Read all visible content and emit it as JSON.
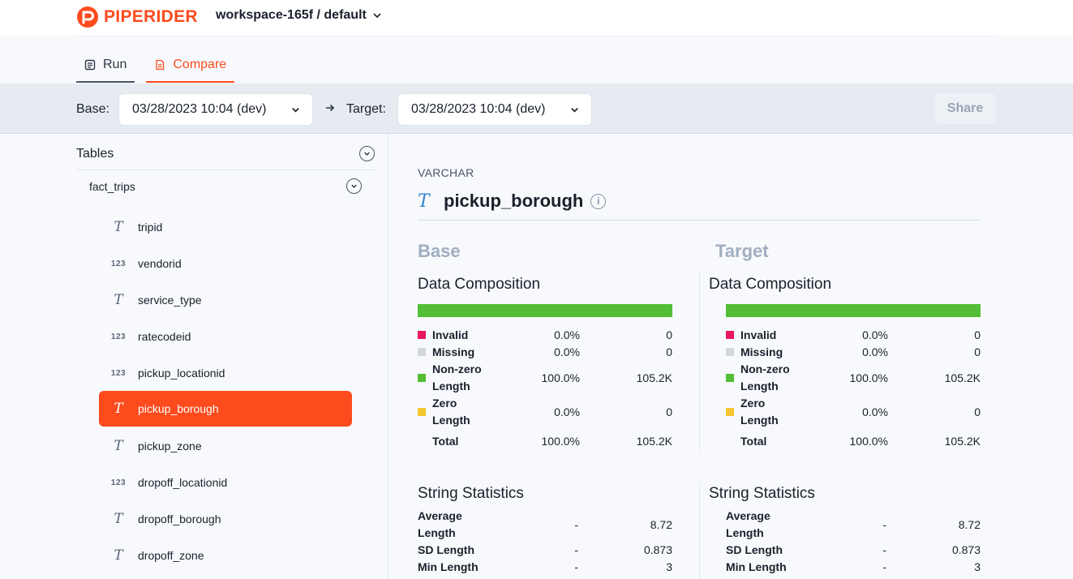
{
  "header": {
    "brand": "PIPERIDER",
    "workspace": "workspace-165f / default"
  },
  "tabs": [
    {
      "label": "Run",
      "icon": "list-icon"
    },
    {
      "label": "Compare",
      "icon": "compare-doc-icon",
      "active": true
    }
  ],
  "compare": {
    "base_label": "Base:",
    "base_value": "03/28/2023 10:04 (dev)",
    "target_label": "Target:",
    "target_value": "03/28/2023 10:04 (dev)",
    "share_label": "Share"
  },
  "sidebar": {
    "title": "Tables",
    "table": "fact_trips",
    "columns": [
      {
        "name": "tripid",
        "type": "text"
      },
      {
        "name": "vendorid",
        "type": "number"
      },
      {
        "name": "service_type",
        "type": "text"
      },
      {
        "name": "ratecodeid",
        "type": "number"
      },
      {
        "name": "pickup_locationid",
        "type": "number"
      },
      {
        "name": "pickup_borough",
        "type": "text",
        "active": true
      },
      {
        "name": "pickup_zone",
        "type": "text"
      },
      {
        "name": "dropoff_locationid",
        "type": "number"
      },
      {
        "name": "dropoff_borough",
        "type": "text"
      },
      {
        "name": "dropoff_zone",
        "type": "text"
      }
    ],
    "type_glyphs": {
      "text": "T",
      "number": "123"
    }
  },
  "main": {
    "data_type": "VARCHAR",
    "column_name": "pickup_borough",
    "info_glyph": "i",
    "base": {
      "title": "Base",
      "composition_title": "Data Composition",
      "composition": [
        {
          "label1": "Invalid",
          "label2": "",
          "pct": "0.0%",
          "count": "0",
          "color": "#e8175d"
        },
        {
          "label1": "Missing",
          "label2": "",
          "pct": "0.0%",
          "count": "0",
          "color": "#d3d6da"
        },
        {
          "label1": "Non-zero",
          "label2": "Length",
          "pct": "100.0%",
          "count": "105.2K",
          "color": "#53bd35"
        },
        {
          "label1": "Zero",
          "label2": "Length",
          "pct": "0.0%",
          "count": "0",
          "color": "#f5c631"
        }
      ],
      "total": {
        "label": "Total",
        "pct": "100.0%",
        "count": "105.2K"
      },
      "string_title": "String Statistics",
      "string_stats": [
        {
          "label1": "Average",
          "label2": "Length",
          "dash": "-",
          "value": "8.72"
        },
        {
          "label1": "SD Length",
          "label2": "",
          "dash": "-",
          "value": "0.873"
        },
        {
          "label1": "Min Length",
          "label2": "",
          "dash": "-",
          "value": "3"
        }
      ]
    },
    "target": {
      "title": "Target",
      "composition_title": "Data Composition",
      "composition": [
        {
          "label1": "Invalid",
          "label2": "",
          "pct": "0.0%",
          "count": "0",
          "color": "#e8175d"
        },
        {
          "label1": "Missing",
          "label2": "",
          "pct": "0.0%",
          "count": "0",
          "color": "#d3d6da"
        },
        {
          "label1": "Non-zero",
          "label2": "Length",
          "pct": "100.0%",
          "count": "105.2K",
          "color": "#53bd35"
        },
        {
          "label1": "Zero",
          "label2": "Length",
          "pct": "0.0%",
          "count": "0",
          "color": "#f5c631"
        }
      ],
      "total": {
        "label": "Total",
        "pct": "100.0%",
        "count": "105.2K"
      },
      "string_title": "String Statistics",
      "string_stats": [
        {
          "label1": "Average",
          "label2": "Length",
          "dash": "-",
          "value": "8.72"
        },
        {
          "label1": "SD Length",
          "label2": "",
          "dash": "-",
          "value": "0.873"
        },
        {
          "label1": "Min Length",
          "label2": "",
          "dash": "-",
          "value": "3"
        }
      ]
    }
  },
  "colors": {
    "brand": "#fd4b1e",
    "nonzero_bar": "#53bd35",
    "text_type_icon": "#3182ce"
  }
}
